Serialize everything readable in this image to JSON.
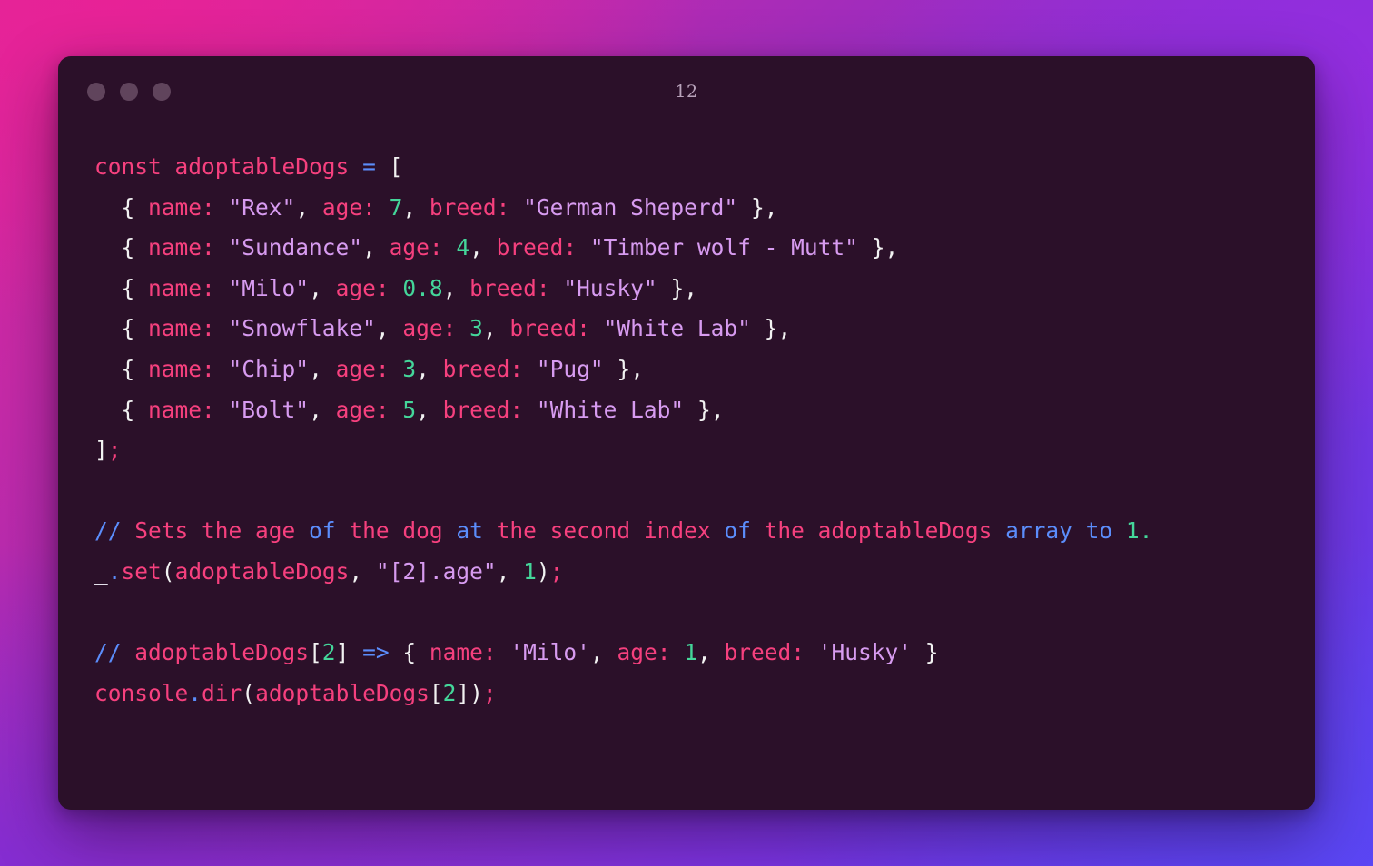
{
  "window": {
    "title": "12",
    "traffic_lights": [
      "close-dot",
      "minimize-dot",
      "maximize-dot"
    ],
    "background_color": "#2b1029",
    "dot_color": "#60445c"
  },
  "theme": {
    "gradient_from": "#e0269b",
    "gradient_to": "#5d45ee",
    "color_keyword": "#f6407e",
    "color_string": "#d79bf0",
    "color_number": "#44d69a",
    "color_operator": "#5b8dfb",
    "color_punctuation": "#f2f2f2"
  },
  "code": {
    "language": "javascript",
    "lines": [
      {
        "id": "l1",
        "text": "const adoptableDogs = ["
      },
      {
        "id": "l2",
        "text": "  { name: \"Rex\", age: 7, breed: \"German Sheperd\" },"
      },
      {
        "id": "l3",
        "text": "  { name: \"Sundance\", age: 4, breed: \"Timber wolf - Mutt\" },"
      },
      {
        "id": "l4",
        "text": "  { name: \"Milo\", age: 0.8, breed: \"Husky\" },"
      },
      {
        "id": "l5",
        "text": "  { name: \"Snowflake\", age: 3, breed: \"White Lab\" },"
      },
      {
        "id": "l6",
        "text": "  { name: \"Chip\", age: 3, breed: \"Pug\" },"
      },
      {
        "id": "l7",
        "text": "  { name: \"Bolt\", age: 5, breed: \"White Lab\" },"
      },
      {
        "id": "l8",
        "text": "];"
      },
      {
        "id": "l9",
        "text": ""
      },
      {
        "id": "l10",
        "text": "// Sets the age of the dog at the second index of the adoptableDogs array to 1."
      },
      {
        "id": "l11",
        "text": "_.set(adoptableDogs, \"[2].age\", 1);"
      },
      {
        "id": "l12",
        "text": ""
      },
      {
        "id": "l13",
        "text": "// adoptableDogs[2] => { name: 'Milo', age: 1, breed: 'Husky' }"
      },
      {
        "id": "l14",
        "text": "console.dir(adoptableDogs[2]);"
      }
    ],
    "tokens": {
      "l1": [
        {
          "t": "const",
          "c": "kw"
        },
        {
          "t": " ",
          "c": "pun"
        },
        {
          "t": "adoptableDogs",
          "c": "kw"
        },
        {
          "t": " ",
          "c": "pun"
        },
        {
          "t": "=",
          "c": "op"
        },
        {
          "t": " ",
          "c": "pun"
        },
        {
          "t": "[",
          "c": "pun"
        }
      ],
      "l2": [
        {
          "t": "  { ",
          "c": "pun"
        },
        {
          "t": "name:",
          "c": "kw"
        },
        {
          "t": " ",
          "c": "pun"
        },
        {
          "t": "\"Rex\"",
          "c": "str"
        },
        {
          "t": ", ",
          "c": "pun"
        },
        {
          "t": "age:",
          "c": "kw"
        },
        {
          "t": " ",
          "c": "pun"
        },
        {
          "t": "7",
          "c": "num"
        },
        {
          "t": ", ",
          "c": "pun"
        },
        {
          "t": "breed:",
          "c": "kw"
        },
        {
          "t": " ",
          "c": "pun"
        },
        {
          "t": "\"German Sheperd\"",
          "c": "str"
        },
        {
          "t": " },",
          "c": "pun"
        }
      ],
      "l3": [
        {
          "t": "  { ",
          "c": "pun"
        },
        {
          "t": "name:",
          "c": "kw"
        },
        {
          "t": " ",
          "c": "pun"
        },
        {
          "t": "\"Sundance\"",
          "c": "str"
        },
        {
          "t": ", ",
          "c": "pun"
        },
        {
          "t": "age:",
          "c": "kw"
        },
        {
          "t": " ",
          "c": "pun"
        },
        {
          "t": "4",
          "c": "num"
        },
        {
          "t": ", ",
          "c": "pun"
        },
        {
          "t": "breed:",
          "c": "kw"
        },
        {
          "t": " ",
          "c": "pun"
        },
        {
          "t": "\"Timber wolf - Mutt\"",
          "c": "str"
        },
        {
          "t": " },",
          "c": "pun"
        }
      ],
      "l4": [
        {
          "t": "  { ",
          "c": "pun"
        },
        {
          "t": "name:",
          "c": "kw"
        },
        {
          "t": " ",
          "c": "pun"
        },
        {
          "t": "\"Milo\"",
          "c": "str"
        },
        {
          "t": ", ",
          "c": "pun"
        },
        {
          "t": "age:",
          "c": "kw"
        },
        {
          "t": " ",
          "c": "pun"
        },
        {
          "t": "0.8",
          "c": "num"
        },
        {
          "t": ", ",
          "c": "pun"
        },
        {
          "t": "breed:",
          "c": "kw"
        },
        {
          "t": " ",
          "c": "pun"
        },
        {
          "t": "\"Husky\"",
          "c": "str"
        },
        {
          "t": " },",
          "c": "pun"
        }
      ],
      "l5": [
        {
          "t": "  { ",
          "c": "pun"
        },
        {
          "t": "name:",
          "c": "kw"
        },
        {
          "t": " ",
          "c": "pun"
        },
        {
          "t": "\"Snowflake\"",
          "c": "str"
        },
        {
          "t": ", ",
          "c": "pun"
        },
        {
          "t": "age:",
          "c": "kw"
        },
        {
          "t": " ",
          "c": "pun"
        },
        {
          "t": "3",
          "c": "num"
        },
        {
          "t": ", ",
          "c": "pun"
        },
        {
          "t": "breed:",
          "c": "kw"
        },
        {
          "t": " ",
          "c": "pun"
        },
        {
          "t": "\"White Lab\"",
          "c": "str"
        },
        {
          "t": " },",
          "c": "pun"
        }
      ],
      "l6": [
        {
          "t": "  { ",
          "c": "pun"
        },
        {
          "t": "name:",
          "c": "kw"
        },
        {
          "t": " ",
          "c": "pun"
        },
        {
          "t": "\"Chip\"",
          "c": "str"
        },
        {
          "t": ", ",
          "c": "pun"
        },
        {
          "t": "age:",
          "c": "kw"
        },
        {
          "t": " ",
          "c": "pun"
        },
        {
          "t": "3",
          "c": "num"
        },
        {
          "t": ", ",
          "c": "pun"
        },
        {
          "t": "breed:",
          "c": "kw"
        },
        {
          "t": " ",
          "c": "pun"
        },
        {
          "t": "\"Pug\"",
          "c": "str"
        },
        {
          "t": " },",
          "c": "pun"
        }
      ],
      "l7": [
        {
          "t": "  { ",
          "c": "pun"
        },
        {
          "t": "name:",
          "c": "kw"
        },
        {
          "t": " ",
          "c": "pun"
        },
        {
          "t": "\"Bolt\"",
          "c": "str"
        },
        {
          "t": ", ",
          "c": "pun"
        },
        {
          "t": "age:",
          "c": "kw"
        },
        {
          "t": " ",
          "c": "pun"
        },
        {
          "t": "5",
          "c": "num"
        },
        {
          "t": ", ",
          "c": "pun"
        },
        {
          "t": "breed:",
          "c": "kw"
        },
        {
          "t": " ",
          "c": "pun"
        },
        {
          "t": "\"White Lab\"",
          "c": "str"
        },
        {
          "t": " },",
          "c": "pun"
        }
      ],
      "l8": [
        {
          "t": "]",
          "c": "pun"
        },
        {
          "t": ";",
          "c": "kw"
        }
      ],
      "l9": [],
      "l10": [
        {
          "t": "// ",
          "c": "op"
        },
        {
          "t": "Sets the ",
          "c": "kw"
        },
        {
          "t": "age ",
          "c": "kw"
        },
        {
          "t": "of ",
          "c": "op"
        },
        {
          "t": "the dog ",
          "c": "kw"
        },
        {
          "t": "at ",
          "c": "op"
        },
        {
          "t": "the second index ",
          "c": "kw"
        },
        {
          "t": "of ",
          "c": "op"
        },
        {
          "t": "the adoptableDogs ",
          "c": "kw"
        },
        {
          "t": "array to ",
          "c": "op"
        },
        {
          "t": "1.",
          "c": "num"
        }
      ],
      "l11": [
        {
          "t": "_",
          "c": "var"
        },
        {
          "t": ".",
          "c": "op"
        },
        {
          "t": "set",
          "c": "kw"
        },
        {
          "t": "(",
          "c": "pun"
        },
        {
          "t": "adoptableDogs",
          "c": "kw"
        },
        {
          "t": ", ",
          "c": "pun"
        },
        {
          "t": "\"[2].age\"",
          "c": "str"
        },
        {
          "t": ", ",
          "c": "pun"
        },
        {
          "t": "1",
          "c": "num"
        },
        {
          "t": ")",
          "c": "pun"
        },
        {
          "t": ";",
          "c": "kw"
        }
      ],
      "l12": [],
      "l13": [
        {
          "t": "// ",
          "c": "op"
        },
        {
          "t": "adoptableDogs",
          "c": "kw"
        },
        {
          "t": "[",
          "c": "pun"
        },
        {
          "t": "2",
          "c": "num"
        },
        {
          "t": "]",
          "c": "pun"
        },
        {
          "t": " ",
          "c": "pun"
        },
        {
          "t": "=>",
          "c": "op"
        },
        {
          "t": " { ",
          "c": "pun"
        },
        {
          "t": "name:",
          "c": "kw"
        },
        {
          "t": " ",
          "c": "pun"
        },
        {
          "t": "'Milo'",
          "c": "str"
        },
        {
          "t": ", ",
          "c": "pun"
        },
        {
          "t": "age:",
          "c": "kw"
        },
        {
          "t": " ",
          "c": "pun"
        },
        {
          "t": "1",
          "c": "num"
        },
        {
          "t": ", ",
          "c": "pun"
        },
        {
          "t": "breed:",
          "c": "kw"
        },
        {
          "t": " ",
          "c": "pun"
        },
        {
          "t": "'Husky'",
          "c": "str"
        },
        {
          "t": " }",
          "c": "pun"
        }
      ],
      "l14": [
        {
          "t": "console",
          "c": "kw"
        },
        {
          "t": ".",
          "c": "op"
        },
        {
          "t": "dir",
          "c": "kw"
        },
        {
          "t": "(",
          "c": "pun"
        },
        {
          "t": "adoptableDogs",
          "c": "kw"
        },
        {
          "t": "[",
          "c": "pun"
        },
        {
          "t": "2",
          "c": "num"
        },
        {
          "t": "]",
          "c": "pun"
        },
        {
          "t": ")",
          "c": "pun"
        },
        {
          "t": ";",
          "c": "kw"
        }
      ]
    }
  }
}
